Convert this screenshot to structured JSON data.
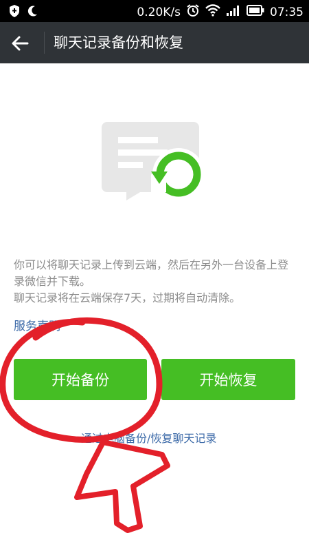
{
  "status_bar": {
    "network_speed": "0.20K/s",
    "time": "07:35",
    "icons": [
      "shield-icon",
      "moon-icon",
      "alarm-icon",
      "wifi-icon",
      "signal-icon",
      "battery-icon"
    ]
  },
  "app_bar": {
    "title": "聊天记录备份和恢复",
    "back_icon": "back-arrow-icon",
    "background": "#2f3337"
  },
  "main": {
    "illustration_icon": "chat-backup-restore-icon",
    "description_lines": [
      "你可以将聊天记录上传到云端，然后在另外一台设备上登录微信并下载。",
      "聊天记录将在云端保存7天，过期将自动清除。"
    ],
    "service_link": "服务声明",
    "buttons": {
      "backup": "开始备份",
      "restore": "开始恢复"
    },
    "pc_link": "通过电脑备份/恢复聊天记录"
  },
  "colors": {
    "accent_green": "#45be24",
    "link_blue": "#3c6aa8",
    "annotation_red": "#e3202a"
  }
}
